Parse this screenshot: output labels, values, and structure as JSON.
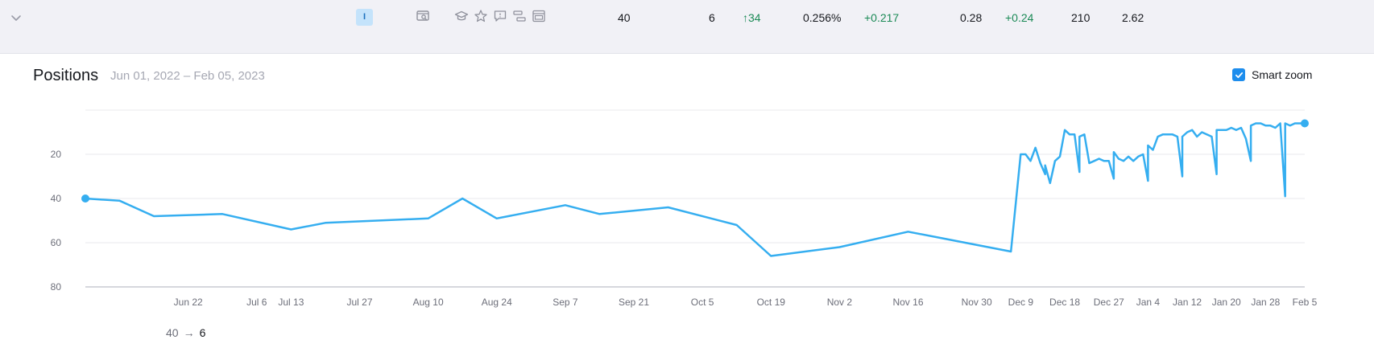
{
  "row": {
    "intent_badge": "I",
    "position": "40",
    "previous_position": "6",
    "position_change": "34",
    "traffic_share": "0.256%",
    "traffic_share_change": "+0.217",
    "traffic": "0.28",
    "traffic_change": "+0.24",
    "volume": "210",
    "cpc": "2.62",
    "icons": [
      "chevron-down-icon",
      "serp-preview-icon",
      "graduation-cap-icon",
      "star-icon",
      "comment-icon",
      "sitelinks-icon",
      "ad-block-icon"
    ]
  },
  "panel": {
    "title": "Positions",
    "date_range": "Jun 01, 2022 – Feb 05, 2023",
    "smart_zoom_label": "Smart zoom",
    "smart_zoom_checked": true,
    "summary_from": "40",
    "summary_to": "6"
  },
  "colors": {
    "line": "#35aef0",
    "badge_bg": "#c4e3fb",
    "positive": "#1b8a56",
    "checkbox": "#1d8ded"
  },
  "chart_data": {
    "type": "line",
    "title": "Positions",
    "y_reversed": true,
    "ylim": [
      0,
      80
    ],
    "yticks": [
      20,
      40,
      60,
      80
    ],
    "xlim": [
      "2022-06-01",
      "2023-02-05"
    ],
    "x_tick_labels": [
      "Jun 22",
      "Jul 6",
      "Jul 13",
      "Jul 27",
      "Aug 10",
      "Aug 24",
      "Sep 7",
      "Sep 21",
      "Oct 5",
      "Oct 19",
      "Nov 2",
      "Nov 16",
      "Nov 30",
      "Dec 9",
      "Dec 18",
      "Dec 27",
      "Jan 4",
      "Jan 12",
      "Jan 20",
      "Jan 28",
      "Feb 5"
    ],
    "x_tick_dates": [
      "2022-06-22",
      "2022-07-06",
      "2022-07-13",
      "2022-07-27",
      "2022-08-10",
      "2022-08-24",
      "2022-09-07",
      "2022-09-21",
      "2022-10-05",
      "2022-10-19",
      "2022-11-02",
      "2022-11-16",
      "2022-11-30",
      "2022-12-09",
      "2022-12-18",
      "2022-12-27",
      "2023-01-04",
      "2023-01-12",
      "2023-01-20",
      "2023-01-28",
      "2023-02-05"
    ],
    "grid": true,
    "series": [
      {
        "points": [
          [
            "2022-06-01",
            40
          ],
          [
            "2022-06-08",
            41
          ],
          [
            "2022-06-15",
            48
          ],
          [
            "2022-06-29",
            47
          ],
          [
            "2022-07-13",
            54
          ],
          [
            "2022-07-20",
            51
          ],
          [
            "2022-08-10",
            49
          ],
          [
            "2022-08-17",
            40
          ],
          [
            "2022-08-24",
            49
          ],
          [
            "2022-09-07",
            43
          ],
          [
            "2022-09-14",
            47
          ],
          [
            "2022-09-28",
            44
          ],
          [
            "2022-10-12",
            52
          ],
          [
            "2022-10-19",
            66
          ],
          [
            "2022-11-02",
            62
          ],
          [
            "2022-11-16",
            55
          ],
          [
            "2022-11-23",
            58
          ],
          [
            "2022-12-07",
            64
          ],
          [
            "2022-12-14",
            29
          ],
          [
            "2022-12-21",
            28
          ],
          [
            "2022-12-28",
            31
          ],
          [
            "2023-01-04",
            32
          ],
          [
            "2023-01-11",
            30
          ],
          [
            "2023-01-18",
            29
          ],
          [
            "2023-01-25",
            23
          ],
          [
            "2023-02-01",
            39
          ],
          [
            "2022-12-09",
            20
          ],
          [
            "2022-12-10",
            20
          ],
          [
            "2022-12-11",
            23
          ],
          [
            "2022-12-12",
            17
          ],
          [
            "2022-12-13",
            24
          ],
          [
            "2022-12-14",
            25
          ],
          [
            "2022-12-15",
            33
          ],
          [
            "2022-12-16",
            23
          ],
          [
            "2022-12-17",
            21
          ],
          [
            "2022-12-18",
            9
          ],
          [
            "2022-12-19",
            11
          ],
          [
            "2022-12-20",
            11
          ],
          [
            "2022-12-21",
            12
          ],
          [
            "2022-12-22",
            11
          ],
          [
            "2022-12-23",
            24
          ],
          [
            "2022-12-24",
            23
          ],
          [
            "2022-12-25",
            22
          ],
          [
            "2022-12-26",
            23
          ],
          [
            "2022-12-27",
            23
          ],
          [
            "2022-12-28",
            19
          ],
          [
            "2022-12-29",
            22
          ],
          [
            "2022-12-30",
            23
          ],
          [
            "2022-12-31",
            21
          ],
          [
            "2023-01-01",
            23
          ],
          [
            "2023-01-02",
            21
          ],
          [
            "2023-01-03",
            20
          ],
          [
            "2023-01-04",
            16
          ],
          [
            "2023-01-05",
            18
          ],
          [
            "2023-01-06",
            12
          ],
          [
            "2023-01-07",
            11
          ],
          [
            "2023-01-08",
            11
          ],
          [
            "2023-01-09",
            11
          ],
          [
            "2023-01-10",
            12
          ],
          [
            "2023-01-11",
            12
          ],
          [
            "2023-01-12",
            10
          ],
          [
            "2023-01-13",
            9
          ],
          [
            "2023-01-14",
            12
          ],
          [
            "2023-01-15",
            10
          ],
          [
            "2023-01-16",
            11
          ],
          [
            "2023-01-17",
            12
          ],
          [
            "2023-01-18",
            9
          ],
          [
            "2023-01-19",
            9
          ],
          [
            "2023-01-20",
            9
          ],
          [
            "2023-01-21",
            8
          ],
          [
            "2023-01-22",
            9
          ],
          [
            "2023-01-23",
            8
          ],
          [
            "2023-01-24",
            13
          ],
          [
            "2023-01-25",
            7
          ],
          [
            "2023-01-26",
            6
          ],
          [
            "2023-01-27",
            6
          ],
          [
            "2023-01-28",
            7
          ],
          [
            "2023-01-29",
            7
          ],
          [
            "2023-01-30",
            8
          ],
          [
            "2023-01-31",
            6
          ],
          [
            "2023-02-01",
            6
          ],
          [
            "2023-02-02",
            7
          ],
          [
            "2023-02-03",
            6
          ],
          [
            "2023-02-04",
            6
          ],
          [
            "2023-02-05",
            6
          ]
        ]
      }
    ]
  }
}
